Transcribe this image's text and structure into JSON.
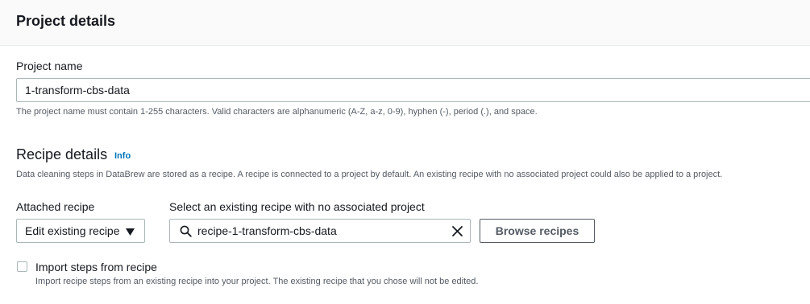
{
  "header": {
    "title": "Project details"
  },
  "project": {
    "name_label": "Project name",
    "name_value": "1-transform-cbs-data",
    "name_help": "The project name must contain 1-255 characters. Valid characters are alphanumeric (A-Z, a-z, 0-9), hyphen (-), period (.), and space."
  },
  "recipe": {
    "title": "Recipe details",
    "info_link": "Info",
    "description": "Data cleaning steps in DataBrew are stored as a recipe. A recipe is connected to a project by default. An existing recipe with no associated project could also be applied to a project.",
    "attached_label": "Attached recipe",
    "attached_value": "Edit existing recipe",
    "select_label": "Select an existing recipe with no associated project",
    "search_value": "recipe-1-transform-cbs-data",
    "browse_button": "Browse recipes"
  },
  "import_steps": {
    "label": "Import steps from recipe",
    "description": "Import recipe steps from an existing recipe into your project. The existing recipe that you chose will not be edited.",
    "checked": false
  },
  "icons": {
    "search": "search-icon",
    "clear": "close-icon",
    "caret": "caret-down-icon"
  },
  "colors": {
    "link": "#0073bb",
    "border": "#aab7b8",
    "text": "#16191f",
    "muted": "#545b64",
    "header_bg": "#fafafa"
  }
}
